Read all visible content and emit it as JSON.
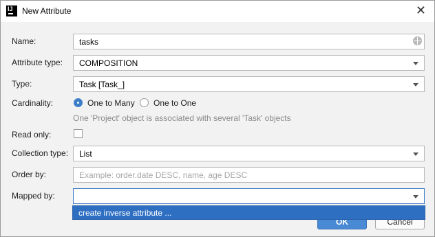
{
  "window": {
    "title": "New Attribute",
    "app_icon": "intellij-icon",
    "close_icon": "close-icon"
  },
  "form": {
    "name": {
      "label": "Name:",
      "value": "tasks"
    },
    "attribute_type": {
      "label": "Attribute type:",
      "value": "COMPOSITION"
    },
    "type": {
      "label": "Type:",
      "value": "Task [Task_]"
    },
    "cardinality": {
      "label": "Cardinality:",
      "options": [
        "One to Many",
        "One to One"
      ],
      "selected": "One to Many",
      "hint": "One 'Project' object is associated with several 'Task' objects"
    },
    "read_only": {
      "label": "Read only:",
      "checked": false
    },
    "collection_type": {
      "label": "Collection type:",
      "value": "List"
    },
    "order_by": {
      "label": "Order by:",
      "value": "",
      "placeholder": "Example: order.date DESC, name, age DESC"
    },
    "mapped_by": {
      "label": "Mapped by:",
      "value": ""
    }
  },
  "dropdown": {
    "items": [
      "create inverse attribute ..."
    ]
  },
  "buttons": {
    "ok": "OK",
    "cancel": "Cancel"
  },
  "colors": {
    "accent": "#2e6fc2",
    "primary_button": "#4a89d3"
  }
}
